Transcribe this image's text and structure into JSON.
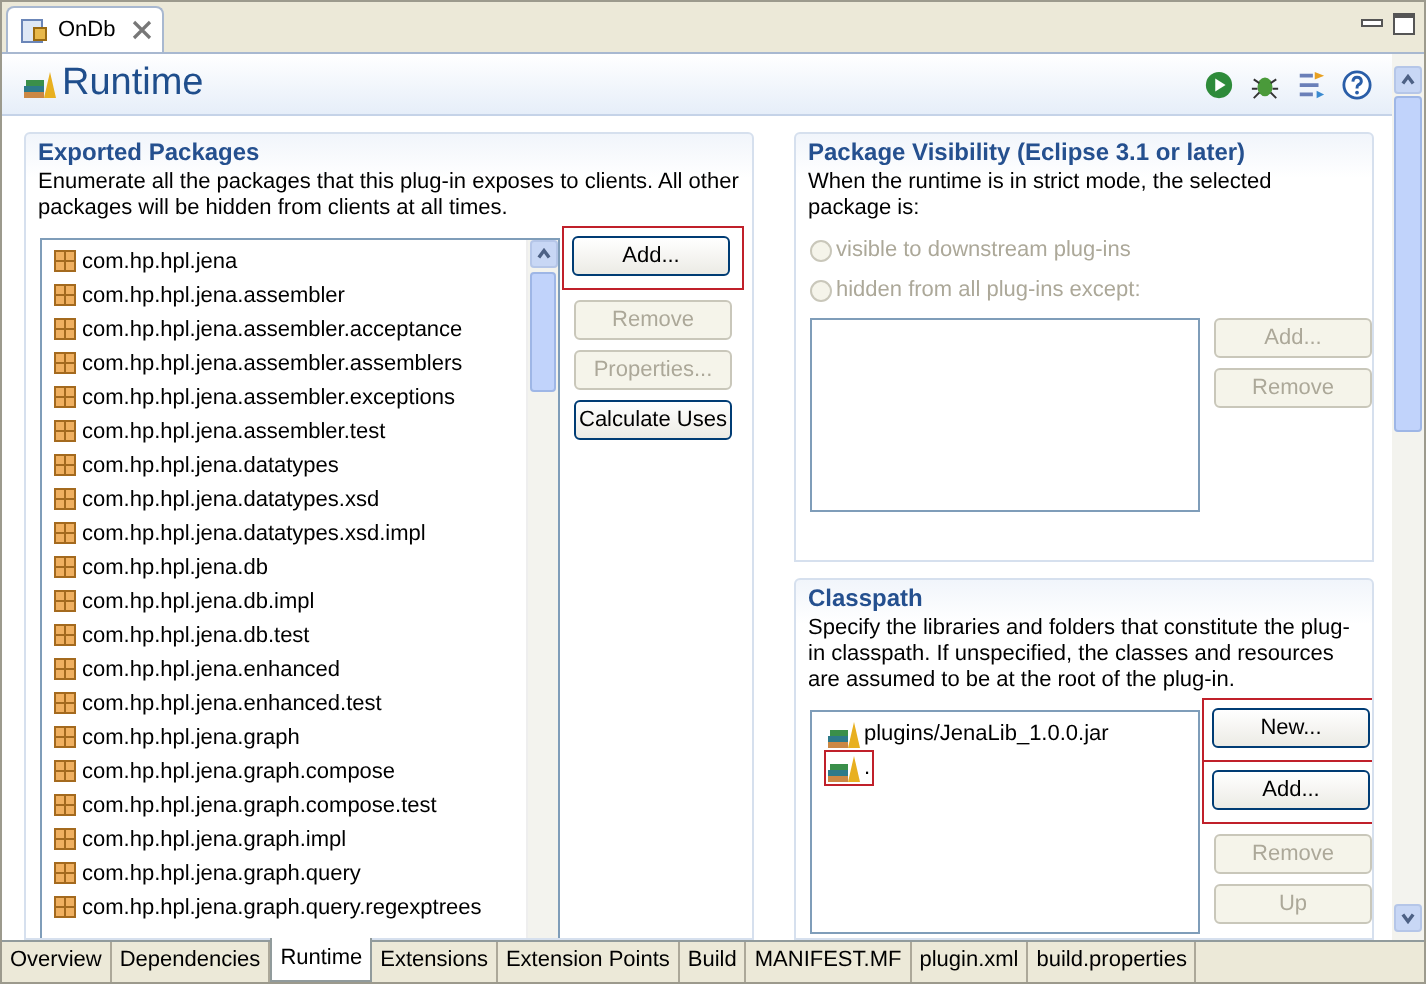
{
  "editor_tab": {
    "title": "OnDb"
  },
  "page": {
    "title": "Runtime"
  },
  "exported_packages": {
    "title": "Exported Packages",
    "description": "Enumerate all the packages that this plug-in exposes to clients.  All other packages will be hidden from clients at all times.",
    "packages": [
      "com.hp.hpl.jena",
      "com.hp.hpl.jena.assembler",
      "com.hp.hpl.jena.assembler.acceptance",
      "com.hp.hpl.jena.assembler.assemblers",
      "com.hp.hpl.jena.assembler.exceptions",
      "com.hp.hpl.jena.assembler.test",
      "com.hp.hpl.jena.datatypes",
      "com.hp.hpl.jena.datatypes.xsd",
      "com.hp.hpl.jena.datatypes.xsd.impl",
      "com.hp.hpl.jena.db",
      "com.hp.hpl.jena.db.impl",
      "com.hp.hpl.jena.db.test",
      "com.hp.hpl.jena.enhanced",
      "com.hp.hpl.jena.enhanced.test",
      "com.hp.hpl.jena.graph",
      "com.hp.hpl.jena.graph.compose",
      "com.hp.hpl.jena.graph.compose.test",
      "com.hp.hpl.jena.graph.impl",
      "com.hp.hpl.jena.graph.query",
      "com.hp.hpl.jena.graph.query.regexptrees"
    ],
    "buttons": [
      {
        "label": "Add...",
        "disabled": false,
        "highlighted": true
      },
      {
        "label": "Remove",
        "disabled": true,
        "highlighted": false
      },
      {
        "label": "Properties...",
        "disabled": true,
        "highlighted": false
      },
      {
        "label": "Calculate Uses",
        "disabled": false,
        "highlighted": false
      }
    ]
  },
  "package_visibility": {
    "title": "Package Visibility (Eclipse 3.1 or later)",
    "description": "When the runtime is in strict mode, the selected package is:",
    "options": [
      {
        "label": "visible to downstream plug-ins",
        "selected": false,
        "disabled": true
      },
      {
        "label": "hidden from all plug-ins except:",
        "selected": false,
        "disabled": true
      }
    ],
    "buttons": [
      {
        "label": "Add...",
        "disabled": true,
        "highlighted": false
      },
      {
        "label": "Remove",
        "disabled": true,
        "highlighted": false
      }
    ]
  },
  "classpath": {
    "title": "Classpath",
    "description": "Specify the libraries and folders that constitute the plug-in classpath.  If unspecified, the classes and resources are assumed to be at the root of the plug-in.",
    "entries": [
      {
        "label": "plugins/JenaLib_1.0.0.jar",
        "highlighted": false
      },
      {
        "label": ".",
        "highlighted": true
      }
    ],
    "buttons": [
      {
        "label": "New...",
        "disabled": false,
        "highlighted": true
      },
      {
        "label": "Add...",
        "disabled": false,
        "highlighted": true
      },
      {
        "label": "Remove",
        "disabled": true,
        "highlighted": false
      },
      {
        "label": "Up",
        "disabled": true,
        "highlighted": false
      }
    ]
  },
  "page_tabs": [
    {
      "label": "Overview",
      "selected": false
    },
    {
      "label": "Dependencies",
      "selected": false
    },
    {
      "label": "Runtime",
      "selected": true
    },
    {
      "label": "Extensions",
      "selected": false
    },
    {
      "label": "Extension Points",
      "selected": false
    },
    {
      "label": "Build",
      "selected": false
    },
    {
      "label": "MANIFEST.MF",
      "selected": false
    },
    {
      "label": "plugin.xml",
      "selected": false
    },
    {
      "label": "build.properties",
      "selected": false
    }
  ]
}
